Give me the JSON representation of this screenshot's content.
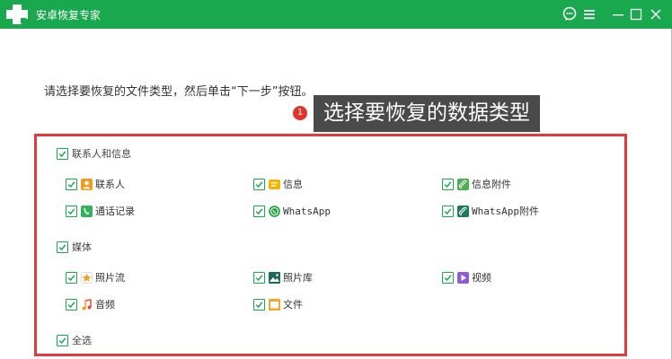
{
  "app": {
    "title": "安卓恢复专家"
  },
  "instruction": "请选择要恢复的文件类型，然后单击“下一步”按钮。",
  "callout": {
    "number": "1",
    "text": "选择要恢复的数据类型"
  },
  "groups": {
    "messages": {
      "label": "联系人和信息",
      "items": [
        "联系人",
        "信息",
        "信息附件",
        "通话记录",
        "WhatsApp",
        "WhatsApp附件"
      ]
    },
    "media": {
      "label": "媒体",
      "items": [
        "照片流",
        "照片库",
        "视频",
        "音频",
        "文件"
      ]
    }
  },
  "select_all": "全选",
  "colors": {
    "titlebar": "#1aa84e",
    "check": "#1aa84e",
    "panel_border": "#e63a3a",
    "callout_bg": "#4a4a4a"
  }
}
